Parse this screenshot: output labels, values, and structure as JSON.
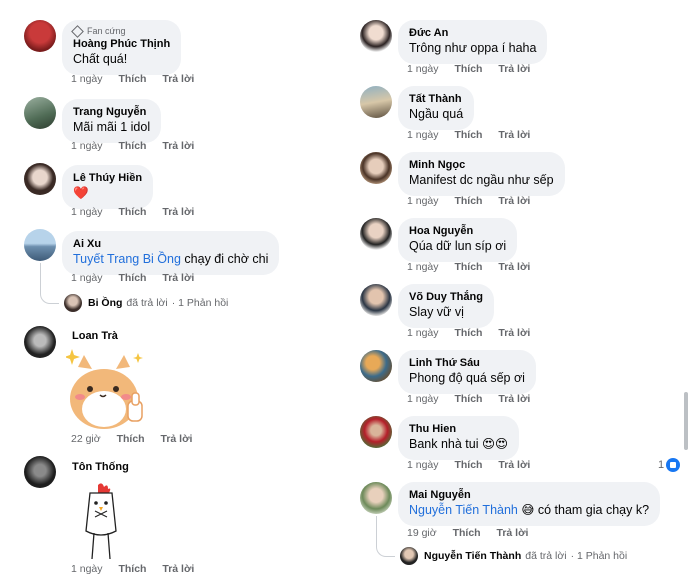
{
  "left_comments": [
    {
      "fan_badge": "Fan cứng",
      "author": "Hoàng Phúc Thịnh",
      "text": "Chất quá!",
      "time": "1 ngày",
      "like": "Thích",
      "reply": "Trả lời"
    },
    {
      "author": "Trang Nguyễn",
      "text": "Mãi mãi 1 idol",
      "time": "1 ngày",
      "like": "Thích",
      "reply": "Trả lời"
    },
    {
      "author": "Lê Thúy Hiền",
      "text": "❤️",
      "time": "1 ngày",
      "like": "Thích",
      "reply": "Trả lời"
    },
    {
      "author": "Ai Xu",
      "mention": "Tuyết Trang Bi Ồng",
      "text": " chạy đi chờ chi",
      "time": "1 ngày",
      "like": "Thích",
      "reply": "Trả lời",
      "reply_summary": {
        "name": "Bi Ồng",
        "action": "đã trả lời",
        "count": "· 1 Phản hồi"
      }
    },
    {
      "author": "Loan Trà",
      "sticker": "hamster-thumbs-up-sticker",
      "time": "22 giờ",
      "like": "Thích",
      "reply": "Trả lời"
    },
    {
      "author": "Tôn Thống",
      "sticker": "chicken-sticker",
      "time": "1 ngày",
      "like": "Thích",
      "reply": "Trả lời"
    }
  ],
  "right_comments": [
    {
      "author": "Đức An",
      "text": "Trông như oppa í haha",
      "time": "1 ngày",
      "like": "Thích",
      "reply": "Trả lời"
    },
    {
      "author": "Tất Thành",
      "text": "Ngầu quá",
      "time": "1 ngày",
      "like": "Thích",
      "reply": "Trả lời"
    },
    {
      "author": "Minh Ngọc",
      "text": "Manifest dc ngầu như sếp",
      "time": "1 ngày",
      "like": "Thích",
      "reply": "Trả lời"
    },
    {
      "author": "Hoa Nguyễn",
      "text": "Qúa dữ lun síp ơi",
      "time": "1 ngày",
      "like": "Thích",
      "reply": "Trả lời"
    },
    {
      "author": "Võ Duy Thắng",
      "text": "Slay vữ vị",
      "time": "1 ngày",
      "like": "Thích",
      "reply": "Trả lời"
    },
    {
      "author": "Linh Thứ Sáu",
      "text": "Phong độ quá sếp ơi",
      "time": "1 ngày",
      "like": "Thích",
      "reply": "Trả lời"
    },
    {
      "author": "Thu Hien",
      "text": "Bank nhà tui 😍😍",
      "time": "1 ngày",
      "like": "Thích",
      "reply": "Trả lời",
      "like_count": "1"
    },
    {
      "author": "Mai Nguyễn",
      "mention": "Nguyễn Tiến Thành",
      "text": " 😅 có tham gia chạy k?",
      "time": "19 giờ",
      "like": "Thích",
      "reply": "Trả lời",
      "reply_summary": {
        "name": "Nguyễn Tiến Thành",
        "action": "đã trả lời",
        "count": "· 1 Phản hồi"
      }
    }
  ],
  "colors": {
    "bubble": "#f0f2f5",
    "mention": "#216fdb",
    "meta": "#65676b",
    "like": "#1877f2"
  }
}
